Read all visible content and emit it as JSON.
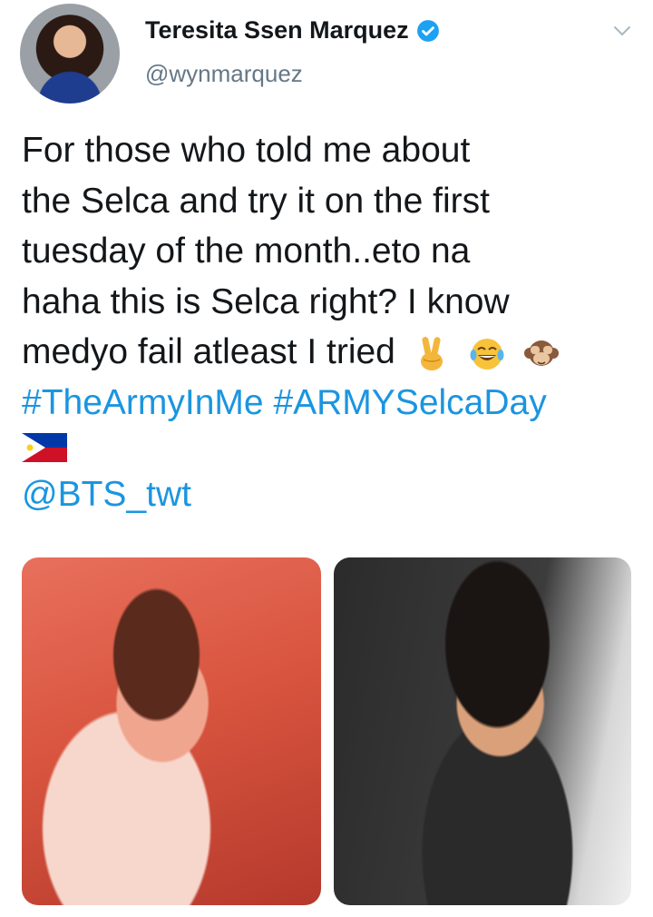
{
  "author": {
    "display_name": "Teresita Ssen Marquez",
    "handle": "@wynmarquez"
  },
  "tweet": {
    "lines": [
      "For those who told me about",
      "the Selca and try it on the first",
      "tuesday of the month..eto na",
      "haha this is Selca right? I know",
      "medyo fail atleast I tried"
    ],
    "emojis": [
      "victory-hand-emoji",
      "tears-of-joy-emoji",
      "see-no-evil-monkey-emoji"
    ],
    "hashtags": [
      "#TheArmyInMe",
      "#ARMYSelcaDay"
    ],
    "flag": "philippines-flag-emoji",
    "mention": "@BTS_twt"
  },
  "colors": {
    "link": "#1b95e0",
    "verified": "#1da1f2",
    "secondary_text": "#657786"
  }
}
